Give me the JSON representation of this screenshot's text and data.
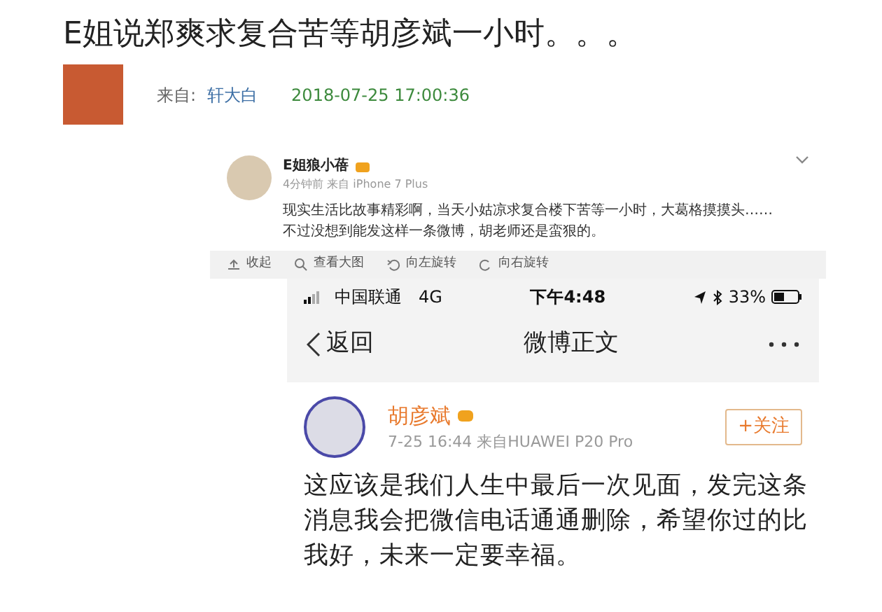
{
  "article": {
    "title": "E姐说郑爽求复合苦等胡彦斌一小时。。。",
    "source_label": "来自:",
    "source_name": "轩大白",
    "timestamp": "2018-07-25 17:00:36"
  },
  "weibo_post": {
    "author": "E姐狼小蓓",
    "meta": "4分钟前 来自 iPhone 7 Plus",
    "text_lines": [
      "现实生活比故事精彩啊，当天小姑凉求复合楼下苦等一小时，大葛格摸摸头……",
      "不过没想到能发这样一条微博，胡老师还是蛮狠的。"
    ],
    "actions": [
      {
        "label": "收起",
        "kind": "collapse"
      },
      {
        "label": "查看大图",
        "kind": "zoom"
      },
      {
        "label": "向左旋转",
        "kind": "rotate-left"
      },
      {
        "label": "向右旋转",
        "kind": "rotate-right"
      }
    ]
  },
  "phone_screenshot": {
    "status_bar": {
      "carrier": "中国联通",
      "network": "4G",
      "time": "下午4:48",
      "battery": "33%"
    },
    "nav": {
      "back": "返回",
      "title": "微博正文"
    },
    "post": {
      "author": "胡彦斌",
      "meta": "7-25 16:44  来自HUAWEI P20 Pro",
      "follow": "+关注",
      "text_lines": [
        "这应该是我们人生中最后一次见面，发完这条",
        "消息我会把微信电话通通删除，希望你过的比",
        "我好，未来一定要幸福。"
      ]
    }
  }
}
